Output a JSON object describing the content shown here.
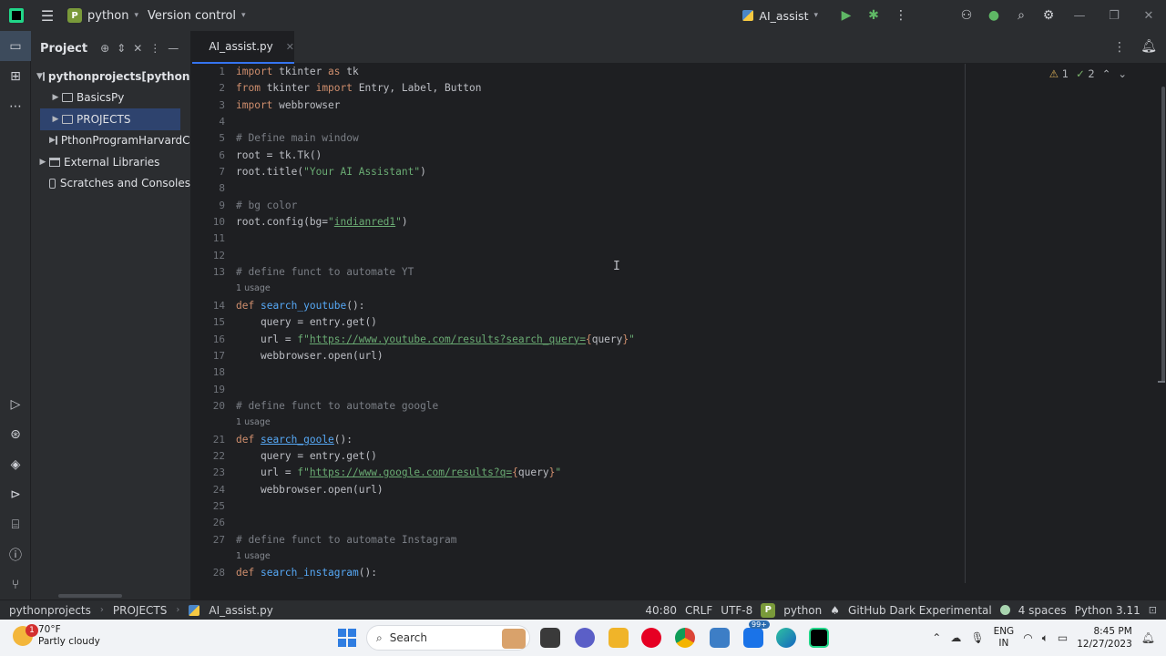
{
  "titlebar": {
    "project_badge": "P",
    "project_name": "python",
    "vcs_label": "Version control",
    "run_config": "AI_assist"
  },
  "project_panel": {
    "title": "Project",
    "tree": [
      {
        "label": "pythonprojects",
        "suffix": " [python]",
        "level": 1,
        "expanded": true
      },
      {
        "label": "BasicsPy",
        "level": 2,
        "expanded": false
      },
      {
        "label": "PROJECTS",
        "level": 2,
        "expanded": false,
        "selected": true
      },
      {
        "label": "PthonProgramHarvardCS",
        "level": 2,
        "expanded": false
      },
      {
        "label": "External Libraries",
        "level": 1,
        "expanded": false
      },
      {
        "label": "Scratches and Consoles",
        "level": 1
      }
    ]
  },
  "editor": {
    "tab_label": "AI_assist.py",
    "inspections": {
      "warnings": "1",
      "weak_warnings": "2"
    },
    "usage_label": "1 usage",
    "line_numbers": [
      "1",
      "2",
      "3",
      "4",
      "5",
      "6",
      "7",
      "8",
      "9",
      "10",
      "11",
      "12",
      "13",
      "",
      "14",
      "15",
      "16",
      "17",
      "18",
      "19",
      "20",
      "",
      "21",
      "22",
      "23",
      "24",
      "25",
      "26",
      "27",
      "",
      "28"
    ]
  },
  "statusbar": {
    "breadcrumb": [
      "pythonprojects",
      "PROJECTS",
      "AI_assist.py"
    ],
    "position": "40:80",
    "line_sep": "CRLF",
    "encoding": "UTF-8",
    "interpreter_badge": "P",
    "interpreter": "python",
    "theme": "GitHub Dark Experimental",
    "indent": "4 spaces",
    "python_version": "Python 3.11"
  },
  "taskbar": {
    "weather_temp": "70°F",
    "weather_desc": "Partly cloudy",
    "weather_badge": "1",
    "search_label": "Search",
    "mail_badge": "99+",
    "lang_line1": "ENG",
    "lang_line2": "IN",
    "time": "8:45 PM",
    "date": "12/27/2023"
  },
  "colors": {
    "accent": "#3574f0",
    "keyword": "#cf8e6d",
    "string": "#6aab73",
    "comment": "#7a7e85",
    "function": "#56a8f5"
  },
  "icons": [
    "pycharm-logo-icon",
    "hamburger-icon",
    "run-icon",
    "debug-icon",
    "more-icon",
    "add-user-icon",
    "search-icon",
    "settings-icon",
    "folder-icon",
    "python-file-icon",
    "notifications-icon",
    "warning-icon",
    "check-icon",
    "windows-start-icon"
  ]
}
